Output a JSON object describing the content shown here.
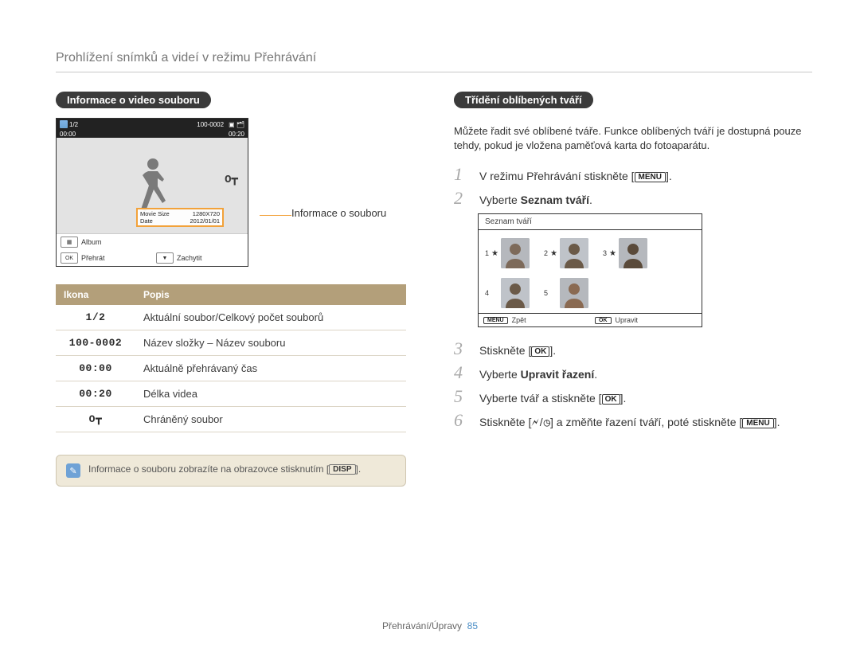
{
  "page": {
    "title": "Prohlížení snímků a videí v režimu Přehrávání",
    "footer_section": "Přehrávání/Úpravy",
    "footer_page": "85"
  },
  "left": {
    "chip": "Informace o video souboru",
    "cam_top": {
      "counter": "1/2",
      "file_id": "100-0002",
      "timer_left": "00:00",
      "timer_right": "00:20"
    },
    "cam_info_box": {
      "row1_label": "Movie Size",
      "row1_val": "1280X720",
      "row2_label": "Date",
      "row2_val": "2012/01/01"
    },
    "callout": "Informace o souboru",
    "cam_footer": {
      "album_label": "Album",
      "play_btn": "OK",
      "play_label": "Přehrát",
      "capture_label": "Zachytit"
    },
    "table_headers": {
      "icon": "Ikona",
      "desc": "Popis"
    },
    "table_rows": [
      {
        "icon": "1/2",
        "desc": "Aktuální soubor/Celkový počet souborů"
      },
      {
        "icon": "100-0002",
        "desc": "Název složky – Název souboru"
      },
      {
        "icon": "00:00",
        "desc": "Aktuálně přehrávaný čas"
      },
      {
        "icon": "00:20",
        "desc": "Délka videa"
      },
      {
        "icon": "key",
        "desc": "Chráněný soubor"
      }
    ],
    "note": {
      "text_before": "Informace o souboru zobrazíte na obrazovce stisknutím [",
      "disp_label": "DISP",
      "text_after": "]."
    }
  },
  "right": {
    "chip": "Třídění oblíbených tváří",
    "intro": "Můžete řadit své oblíbené tváře. Funkce oblíbených tváří je dostupná pouze tehdy, pokud je vložena paměťová karta do fotoaparátu.",
    "steps": {
      "s1_before": "V režimu Přehrávání stiskněte [",
      "s1_menu": "MENU",
      "s1_after": "].",
      "s2_before": "Vyberte ",
      "s2_bold": "Seznam tváří",
      "s2_after": ".",
      "s3_before": "Stiskněte [",
      "s3_ok": "OK",
      "s3_after": "].",
      "s4_before": "Vyberte ",
      "s4_bold": "Upravit řazení",
      "s4_after": ".",
      "s5_before": "Vyberte tvář a stiskněte [",
      "s5_ok": "OK",
      "s5_after": "].",
      "s6_before": "Stiskněte [",
      "s6_flash": "⚡",
      "s6_clock": "🕓",
      "s6_mid": "] a změňte řazení tváří, poté stiskněte [",
      "s6_menu": "MENU",
      "s6_after": "]."
    },
    "face_panel": {
      "title": "Seznam tváří",
      "back_btn": "MENU",
      "back_label": "Zpět",
      "edit_btn": "OK",
      "edit_label": "Upravit",
      "items": [
        {
          "n": "1",
          "star": true
        },
        {
          "n": "2",
          "star": true
        },
        {
          "n": "3",
          "star": true
        },
        {
          "n": "4",
          "star": false
        },
        {
          "n": "5",
          "star": false
        }
      ]
    }
  }
}
